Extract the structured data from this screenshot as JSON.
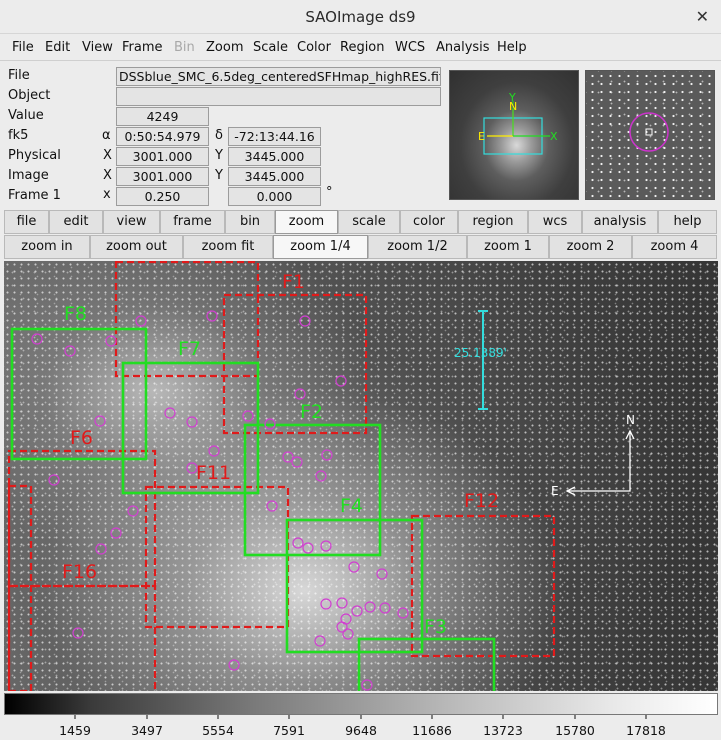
{
  "window": {
    "title": "SAOImage ds9",
    "close_glyph": "✕"
  },
  "menu": [
    "File",
    "Edit",
    "View",
    "Frame",
    "Bin",
    "Zoom",
    "Scale",
    "Color",
    "Region",
    "WCS",
    "Analysis",
    "Help"
  ],
  "menu_disabled": "Bin",
  "info": {
    "file_label": "File",
    "file_value": "DSSblue_SMC_6.5deg_centeredSFHmap_highRES.fits",
    "object_label": "Object",
    "object_value": "",
    "value_label": "Value",
    "value_value": "4249",
    "wcs_label": "fk5",
    "wcs_a_label": "α",
    "wcs_a_value": "0:50:54.979",
    "wcs_d_label": "δ",
    "wcs_d_value": "-72:13:44.16",
    "physical_label": "Physical",
    "physical_x_label": "X",
    "physical_x": "3001.000",
    "physical_y_label": "Y",
    "physical_y": "3445.000",
    "image_label": "Image",
    "image_x_label": "X",
    "image_x": "3001.000",
    "image_y_label": "Y",
    "image_y": "3445.000",
    "frame_label": "Frame 1",
    "frame_x_label": "x",
    "frame_zoom": "0.250",
    "frame_angle": "0.000",
    "frame_angle_unit": "°"
  },
  "buttonbar": [
    "file",
    "edit",
    "view",
    "frame",
    "bin",
    "zoom",
    "scale",
    "color",
    "region",
    "wcs",
    "analysis",
    "help"
  ],
  "buttonbar_active": "zoom",
  "zoombar": [
    "zoom in",
    "zoom out",
    "zoom fit",
    "zoom 1/4",
    "zoom 1/2",
    "zoom 1",
    "zoom 2",
    "zoom 4"
  ],
  "zoombar_active": "zoom 1/4",
  "panner": {
    "north": "N",
    "east": "E",
    "x": "X",
    "y": "Y"
  },
  "image_overlay": {
    "field_labels": [
      "F1",
      "F8",
      "F7",
      "F6",
      "F2",
      "F11",
      "F4",
      "F12",
      "F16",
      "F3"
    ],
    "scale_bar": "25.1389'",
    "compass_north": "N",
    "compass_east": "E",
    "colors": {
      "red": "#e01a1a",
      "green": "#22dd22",
      "magenta": "#d040d0",
      "cyan": "#33dddd",
      "white": "#ffffff"
    }
  },
  "colorbar_ticks": [
    "1459",
    "3497",
    "5554",
    "7591",
    "9648",
    "11686",
    "13723",
    "15780",
    "17818"
  ]
}
